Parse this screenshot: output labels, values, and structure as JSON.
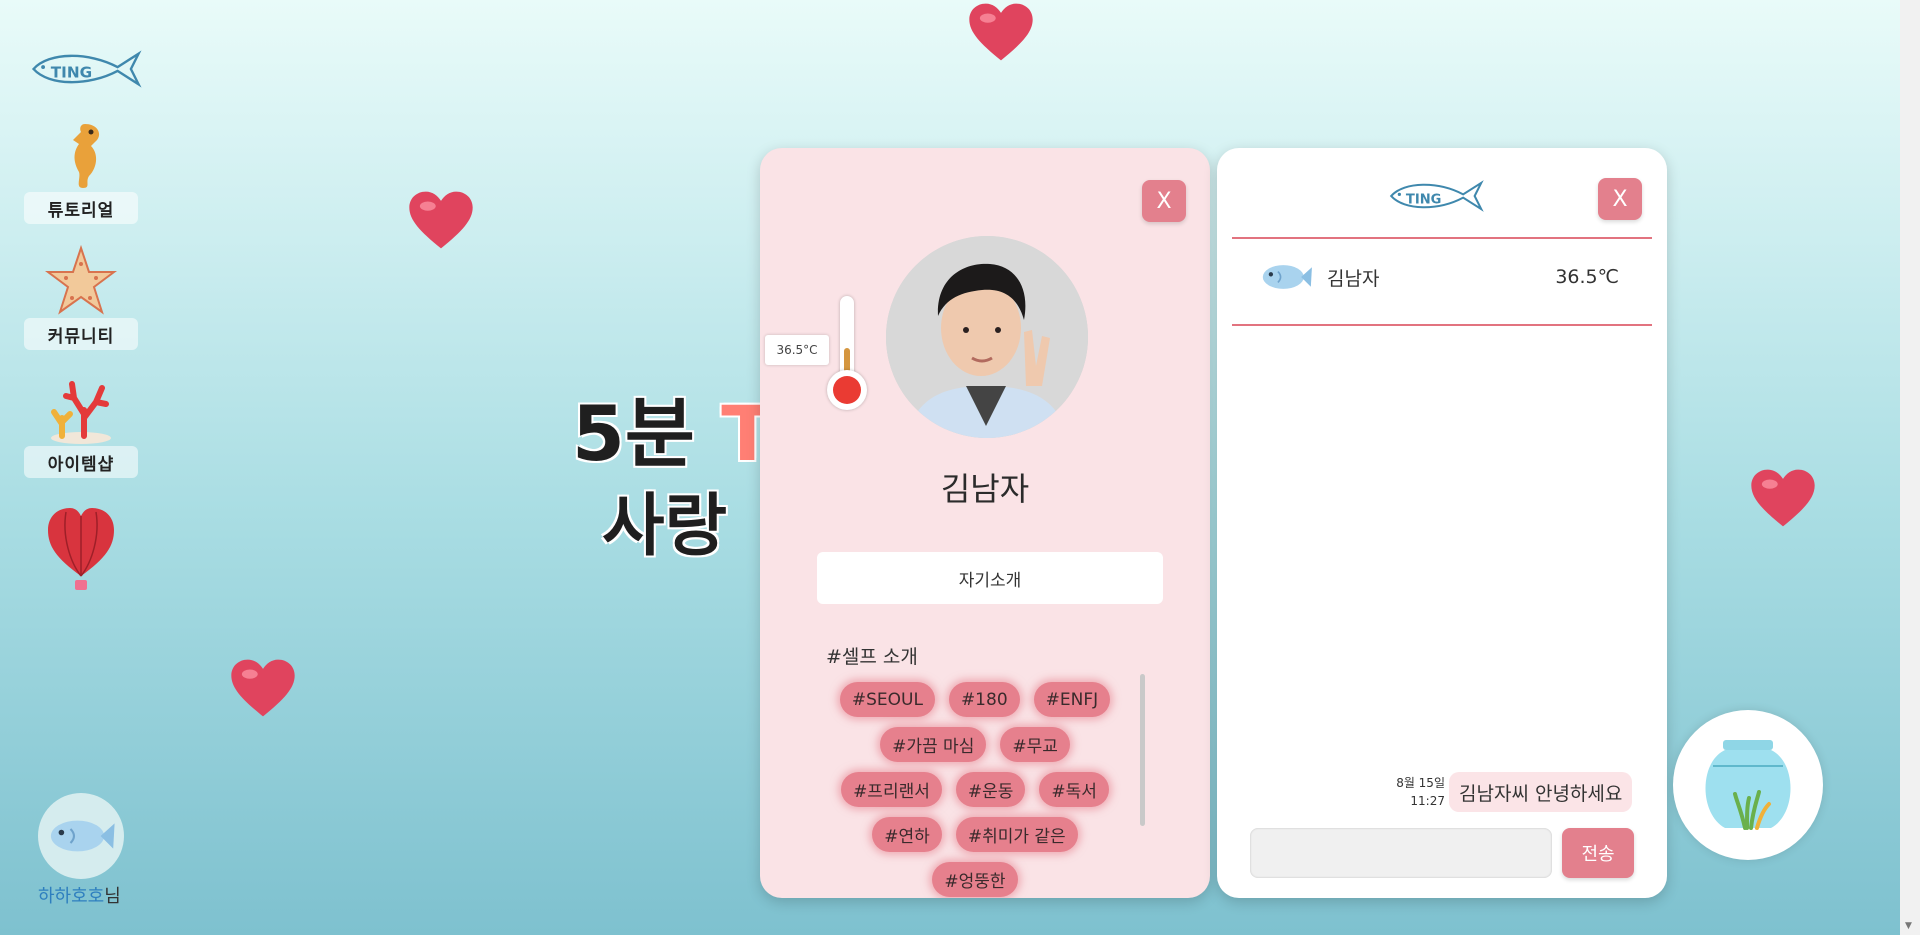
{
  "sidebar": {
    "logo_text": "TING",
    "items": [
      {
        "label": "튜토리얼",
        "icon": "seahorse-icon"
      },
      {
        "label": "커뮤니티",
        "icon": "starfish-icon"
      },
      {
        "label": "아이템샵",
        "icon": "coral-icon"
      }
    ],
    "balloon_icon": "heart-balloon-icon",
    "user": {
      "name": "하하호호",
      "suffix": "님",
      "avatar_icon": "fish-icon"
    }
  },
  "hero": {
    "line1_prefix": "5분",
    "line1_accent": "TI",
    "line2": "사랑"
  },
  "profile": {
    "close_label": "X",
    "temperature": "36.5°C",
    "name": "김남자",
    "intro_button": "자기소개",
    "tags_title": "#셀프 소개",
    "tags": [
      "#SEOUL",
      "#180",
      "#ENFJ",
      "#가끔 마심",
      "#무교",
      "#프리랜서",
      "#운동",
      "#독서",
      "#연하",
      "#취미가 같은",
      "#엉뚱한"
    ]
  },
  "chat": {
    "logo_text": "TING",
    "close_label": "X",
    "partner": {
      "name": "김남자",
      "temperature": "36.5℃",
      "icon": "fish-icon"
    },
    "messages": [
      {
        "date": "8월 15일",
        "time": "11:27",
        "text": "김남자씨 안녕하세요"
      }
    ],
    "input_value": "",
    "send_label": "전송"
  },
  "fishbowl_icon": "fishbowl-icon",
  "colors": {
    "accent": "#e3808d",
    "tag": "#e6808d",
    "panel_pink": "#fae3e6",
    "user_name": "#2e7fbf"
  }
}
